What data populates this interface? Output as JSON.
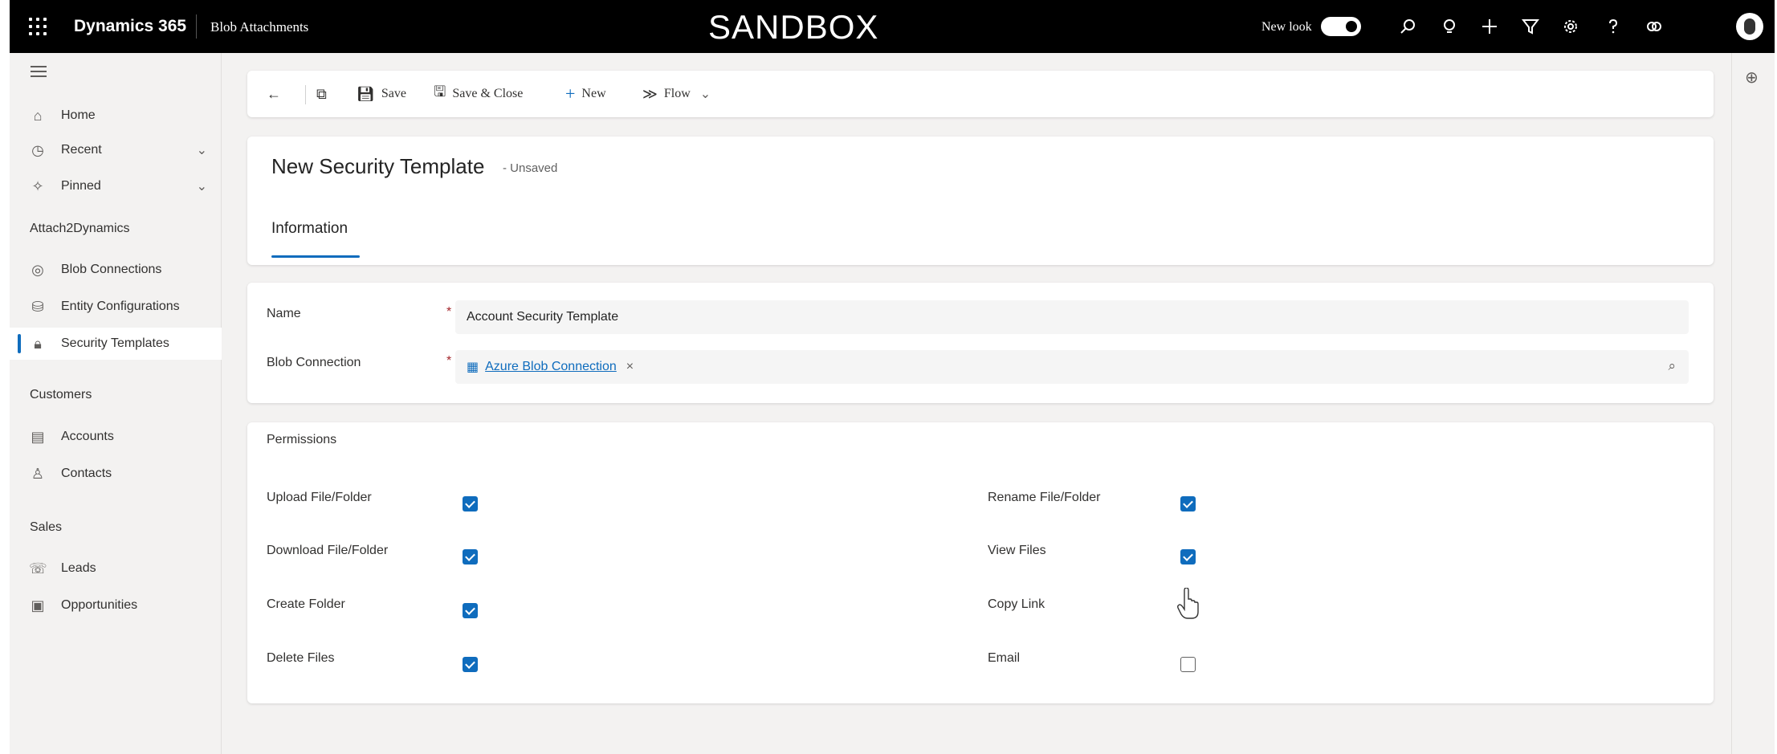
{
  "topbar": {
    "app_name": "Dynamics 365",
    "page_name": "Blob Attachments",
    "environment": "SANDBOX",
    "new_look_label": "New look",
    "new_look_enabled": true,
    "icons": [
      "search-icon",
      "lightbulb-icon",
      "plus-icon",
      "filter-icon",
      "settings-icon",
      "help-icon",
      "copilot-icon"
    ]
  },
  "sidebar": {
    "items": [
      {
        "label": "Home",
        "icon": "home-icon"
      },
      {
        "label": "Recent",
        "icon": "clock-icon",
        "expandable": true
      },
      {
        "label": "Pinned",
        "icon": "pin-icon",
        "expandable": true
      }
    ],
    "sections": [
      {
        "title": "Attach2Dynamics",
        "items": [
          {
            "label": "Blob Connections",
            "icon": "connection-icon"
          },
          {
            "label": "Entity Configurations",
            "icon": "config-icon"
          },
          {
            "label": "Security Templates",
            "icon": "lock-icon",
            "active": true
          }
        ]
      },
      {
        "title": "Customers",
        "items": [
          {
            "label": "Accounts",
            "icon": "account-icon"
          },
          {
            "label": "Contacts",
            "icon": "person-icon"
          }
        ]
      },
      {
        "title": "Sales",
        "items": [
          {
            "label": "Leads",
            "icon": "leads-icon"
          },
          {
            "label": "Opportunities",
            "icon": "opportunity-icon"
          }
        ]
      }
    ]
  },
  "commandbar": {
    "save": "Save",
    "save_close": "Save & Close",
    "new": "New",
    "flow": "Flow"
  },
  "form": {
    "title": "New Security Template",
    "status": "- Unsaved",
    "tab": "Information"
  },
  "general": {
    "name_label": "Name",
    "name_value": "Account Security Template",
    "required_marker": "*",
    "blob_label": "Blob Connection",
    "blob_value": "Azure Blob Connection",
    "remove_glyph": "×"
  },
  "permissions": {
    "title": "Permissions",
    "left": [
      {
        "label": "Upload File/Folder",
        "checked": true
      },
      {
        "label": "Download File/Folder",
        "checked": true
      },
      {
        "label": "Create Folder",
        "checked": true
      },
      {
        "label": "Delete Files",
        "checked": true
      }
    ],
    "right": [
      {
        "label": "Rename File/Folder",
        "checked": true
      },
      {
        "label": "View Files",
        "checked": true
      },
      {
        "label": "Copy Link",
        "checked": false
      },
      {
        "label": "Email",
        "checked": false
      }
    ]
  },
  "colors": {
    "accent": "#0f6cbd",
    "topbar": "#000000",
    "canvas": "#f3f2f1"
  }
}
